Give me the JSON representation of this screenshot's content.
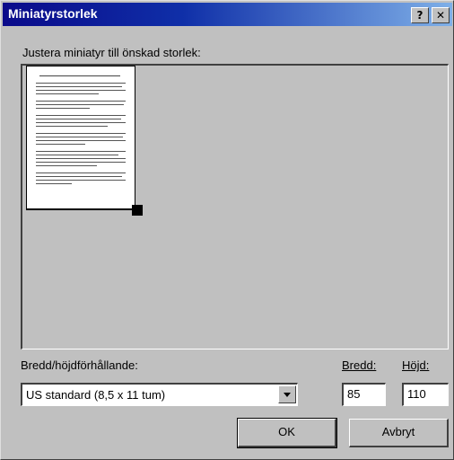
{
  "window": {
    "title": "Miniatyrstorlek"
  },
  "titlebar_buttons": {
    "help": "?",
    "close": "✕"
  },
  "instruction": "Justera miniatyr till önskad storlek:",
  "aspect": {
    "label": "Bredd/höjdförhållande:",
    "selected": "US standard (8,5 x 11 tum)"
  },
  "width": {
    "label": "Bredd:",
    "value": "85"
  },
  "height": {
    "label": "Höjd:",
    "value": "110"
  },
  "buttons": {
    "ok": "OK",
    "cancel": "Avbryt"
  }
}
